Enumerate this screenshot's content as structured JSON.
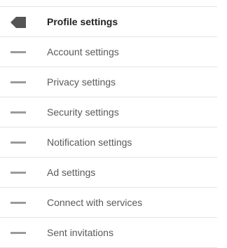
{
  "settings_menu": {
    "items": [
      {
        "label": "Profile settings",
        "icon": "active-arrow-icon",
        "active": true
      },
      {
        "label": "Account settings",
        "icon": "dash-icon",
        "active": false
      },
      {
        "label": "Privacy settings",
        "icon": "dash-icon",
        "active": false
      },
      {
        "label": "Security settings",
        "icon": "dash-icon",
        "active": false
      },
      {
        "label": "Notification settings",
        "icon": "dash-icon",
        "active": false
      },
      {
        "label": "Ad settings",
        "icon": "dash-icon",
        "active": false
      },
      {
        "label": "Connect with services",
        "icon": "dash-icon",
        "active": false
      },
      {
        "label": "Sent invitations",
        "icon": "dash-icon",
        "active": false
      }
    ],
    "colors": {
      "active_icon": "#555555",
      "dash_icon": "#9a9a9a",
      "divider": "#e4e4e4",
      "active_text": "#222222",
      "inactive_text": "#5a5a5a"
    }
  }
}
